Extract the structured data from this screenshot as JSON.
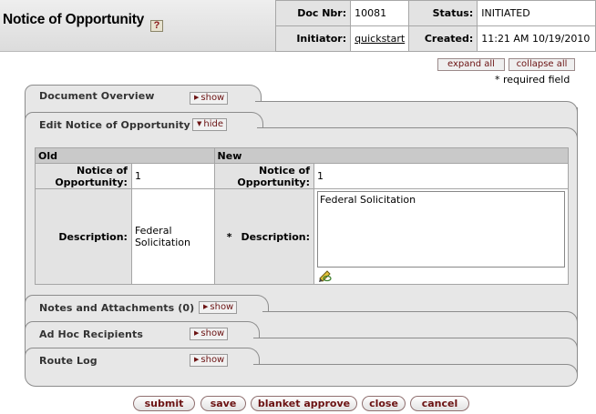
{
  "header": {
    "title": "Notice of Opportunity",
    "help": "?",
    "doc_nbr_label": "Doc Nbr:",
    "doc_nbr": "10081",
    "status_label": "Status:",
    "status": "INITIATED",
    "initiator_label": "Initiator:",
    "initiator": "quickstart",
    "created_label": "Created:",
    "created": "11:21 AM 10/19/2010"
  },
  "controls": {
    "expand_all": "expand all",
    "collapse_all": "collapse all",
    "required_note": "* required field"
  },
  "tabs": {
    "document_overview": {
      "title": "Document Overview",
      "toggle": "show"
    },
    "edit": {
      "title": "Edit Notice of Opportunity",
      "toggle": "hide"
    },
    "notes": {
      "title": "Notes and Attachments (0)",
      "toggle": "show"
    },
    "adhoc": {
      "title": "Ad Hoc Recipients",
      "toggle": "show"
    },
    "route_log": {
      "title": "Route Log",
      "toggle": "show"
    }
  },
  "maintenance": {
    "old_header": "Old",
    "new_header": "New",
    "notice_label": "Notice of Opportunity:",
    "description_label": "Description:",
    "required_star": "*",
    "old": {
      "notice": "1",
      "description": "Federal Solicitation"
    },
    "new": {
      "notice": "1",
      "description": "Federal Solicitation"
    }
  },
  "buttons": {
    "submit": "submit",
    "save": "save",
    "blanket_approve": "blanket approve",
    "close": "close",
    "cancel": "cancel"
  },
  "colors": {
    "button_text": "#6b1212",
    "tab_bg": "#e7e7e7",
    "header_bg": "#dcdcdc"
  }
}
